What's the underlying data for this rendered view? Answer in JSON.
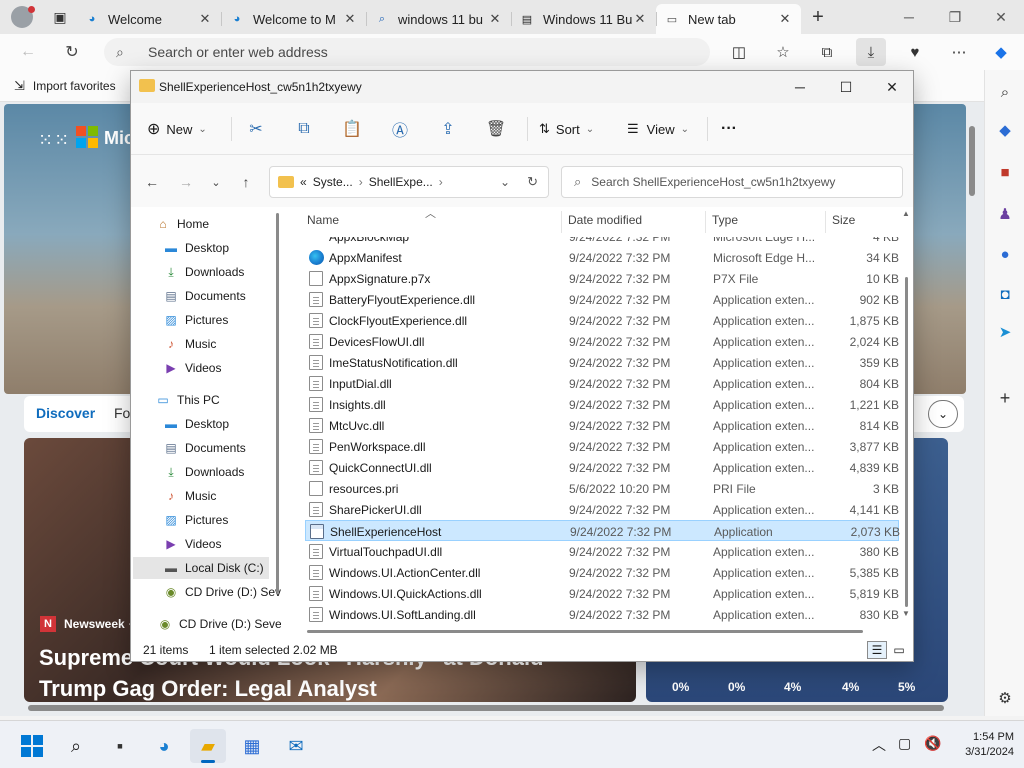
{
  "browser": {
    "tabs": [
      {
        "label": "Welcome",
        "icon": "edge-icon",
        "active": false
      },
      {
        "label": "Welcome to M",
        "icon": "edge-icon",
        "active": false
      },
      {
        "label": "windows 11 bu",
        "icon": "search-icon",
        "active": false
      },
      {
        "label": "Windows 11 Bu",
        "icon": "news-icon",
        "active": false
      },
      {
        "label": "New tab",
        "icon": "newtab-icon",
        "active": true
      }
    ],
    "address_placeholder": "Search or enter web address",
    "favorites": {
      "import_label": "Import favorites"
    }
  },
  "newtab": {
    "brand_text": "Micr",
    "feed_tabs": [
      "Discover",
      "Fo"
    ],
    "news": {
      "source": "Newsweek",
      "source_suffix": "·",
      "headline": "Supreme Court Would Look \"Harshly\" at Donald Trump Gag Order: Legal Analyst"
    },
    "weather_precip": [
      "0%",
      "0%",
      "4%",
      "4%",
      "5%"
    ]
  },
  "explorer": {
    "title": "ShellExperienceHost_cw5n1h2txyewy",
    "commands": {
      "new": "New",
      "sort": "Sort",
      "view": "View",
      "more": "···"
    },
    "path": {
      "prefix": "«",
      "segments": [
        "Syste...",
        "ShellExpe..."
      ]
    },
    "search_placeholder": "Search ShellExperienceHost_cw5n1h2txyewy",
    "tree": [
      {
        "label": "Home",
        "icon": "home-icon",
        "indent": 0,
        "pinned": false
      },
      {
        "label": "Desktop",
        "icon": "desktop-icon",
        "indent": 1,
        "pinned": true
      },
      {
        "label": "Downloads",
        "icon": "download-icon",
        "indent": 1,
        "pinned": true
      },
      {
        "label": "Documents",
        "icon": "documents-icon",
        "indent": 1,
        "pinned": true
      },
      {
        "label": "Pictures",
        "icon": "pictures-icon",
        "indent": 1,
        "pinned": true
      },
      {
        "label": "Music",
        "icon": "music-icon",
        "indent": 1,
        "pinned": false
      },
      {
        "label": "Videos",
        "icon": "videos-icon",
        "indent": 1,
        "pinned": false
      },
      {
        "label": "This PC",
        "icon": "pc-icon",
        "indent": 0,
        "pinned": false
      },
      {
        "label": "Desktop",
        "icon": "desktop-icon",
        "indent": 1,
        "pinned": false
      },
      {
        "label": "Documents",
        "icon": "documents-icon",
        "indent": 1,
        "pinned": false
      },
      {
        "label": "Downloads",
        "icon": "download-icon",
        "indent": 1,
        "pinned": false
      },
      {
        "label": "Music",
        "icon": "music-icon",
        "indent": 1,
        "pinned": false
      },
      {
        "label": "Pictures",
        "icon": "pictures-icon",
        "indent": 1,
        "pinned": false
      },
      {
        "label": "Videos",
        "icon": "videos-icon",
        "indent": 1,
        "pinned": false
      },
      {
        "label": "Local Disk (C:)",
        "icon": "disk-icon",
        "indent": 1,
        "pinned": false,
        "selected": true
      },
      {
        "label": "CD Drive (D:) Sev",
        "icon": "cd-icon",
        "indent": 1,
        "pinned": false
      },
      {
        "label": "CD Drive (D:) Seve",
        "icon": "cd-icon",
        "indent": 0,
        "pinned": false
      }
    ],
    "columns": {
      "name": "Name",
      "date": "Date modified",
      "type": "Type",
      "size": "Size"
    },
    "partial_row": {
      "name": "AppxBlockMap",
      "date": "9/24/2022 7:32 PM",
      "type": "Microsoft Edge H...",
      "size": "4 KB"
    },
    "files": [
      {
        "name": "AppxManifest",
        "date": "9/24/2022 7:32 PM",
        "type": "Microsoft Edge H...",
        "size": "34 KB",
        "kind": "edge"
      },
      {
        "name": "AppxSignature.p7x",
        "date": "9/24/2022 7:32 PM",
        "type": "P7X File",
        "size": "10 KB",
        "kind": "file"
      },
      {
        "name": "BatteryFlyoutExperience.dll",
        "date": "9/24/2022 7:32 PM",
        "type": "Application exten...",
        "size": "902 KB",
        "kind": "dll"
      },
      {
        "name": "ClockFlyoutExperience.dll",
        "date": "9/24/2022 7:32 PM",
        "type": "Application exten...",
        "size": "1,875 KB",
        "kind": "dll"
      },
      {
        "name": "DevicesFlowUI.dll",
        "date": "9/24/2022 7:32 PM",
        "type": "Application exten...",
        "size": "2,024 KB",
        "kind": "dll"
      },
      {
        "name": "ImeStatusNotification.dll",
        "date": "9/24/2022 7:32 PM",
        "type": "Application exten...",
        "size": "359 KB",
        "kind": "dll"
      },
      {
        "name": "InputDial.dll",
        "date": "9/24/2022 7:32 PM",
        "type": "Application exten...",
        "size": "804 KB",
        "kind": "dll"
      },
      {
        "name": "Insights.dll",
        "date": "9/24/2022 7:32 PM",
        "type": "Application exten...",
        "size": "1,221 KB",
        "kind": "dll"
      },
      {
        "name": "MtcUvc.dll",
        "date": "9/24/2022 7:32 PM",
        "type": "Application exten...",
        "size": "814 KB",
        "kind": "dll"
      },
      {
        "name": "PenWorkspace.dll",
        "date": "9/24/2022 7:32 PM",
        "type": "Application exten...",
        "size": "3,877 KB",
        "kind": "dll"
      },
      {
        "name": "QuickConnectUI.dll",
        "date": "9/24/2022 7:32 PM",
        "type": "Application exten...",
        "size": "4,839 KB",
        "kind": "dll"
      },
      {
        "name": "resources.pri",
        "date": "5/6/2022 10:20 PM",
        "type": "PRI File",
        "size": "3 KB",
        "kind": "file"
      },
      {
        "name": "SharePickerUI.dll",
        "date": "9/24/2022 7:32 PM",
        "type": "Application exten...",
        "size": "4,141 KB",
        "kind": "dll"
      },
      {
        "name": "ShellExperienceHost",
        "date": "9/24/2022 7:32 PM",
        "type": "Application",
        "size": "2,073 KB",
        "kind": "app",
        "selected": true
      },
      {
        "name": "VirtualTouchpadUI.dll",
        "date": "9/24/2022 7:32 PM",
        "type": "Application exten...",
        "size": "380 KB",
        "kind": "dll"
      },
      {
        "name": "Windows.UI.ActionCenter.dll",
        "date": "9/24/2022 7:32 PM",
        "type": "Application exten...",
        "size": "5,385 KB",
        "kind": "dll"
      },
      {
        "name": "Windows.UI.QuickActions.dll",
        "date": "9/24/2022 7:32 PM",
        "type": "Application exten...",
        "size": "5,819 KB",
        "kind": "dll"
      },
      {
        "name": "Windows.UI.SoftLanding.dll",
        "date": "9/24/2022 7:32 PM",
        "type": "Application exten...",
        "size": "830 KB",
        "kind": "dll"
      }
    ],
    "status": {
      "items": "21 items",
      "selected": "1 item selected",
      "size": "2.02 MB"
    }
  },
  "taskbar": {
    "time": "1:54 PM",
    "date": "3/31/2024"
  },
  "colors": {
    "accent": "#0078d4",
    "selection": "#cce8ff",
    "folder": "#f2c14e"
  }
}
